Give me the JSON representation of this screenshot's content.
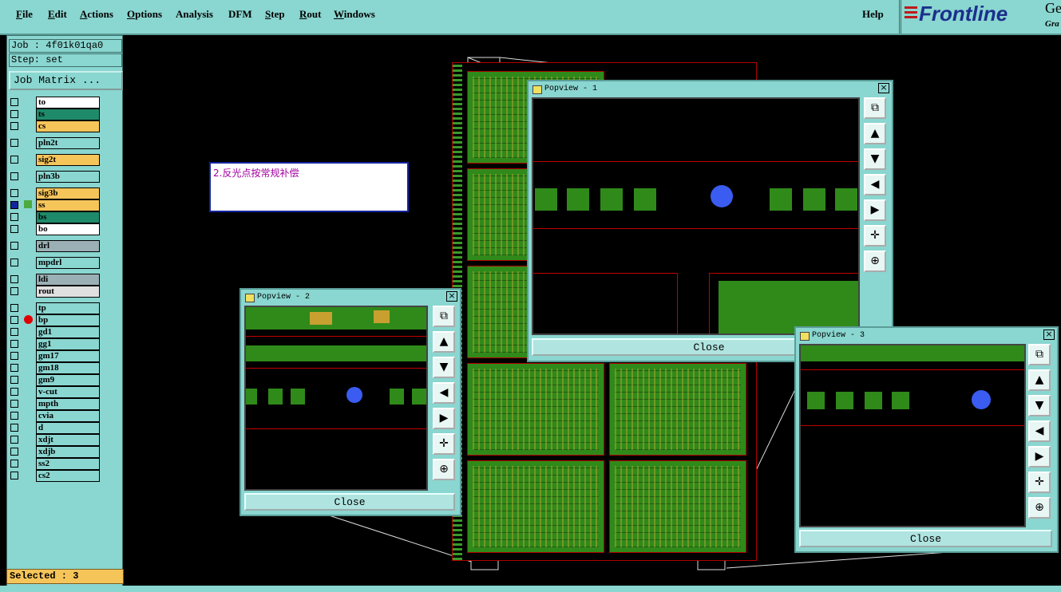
{
  "menu": {
    "items": [
      {
        "label": "File",
        "u": "F",
        "rest": "ile"
      },
      {
        "label": "Edit",
        "u": "E",
        "rest": "dit"
      },
      {
        "label": "Actions",
        "u": "A",
        "rest": "ctions"
      },
      {
        "label": "Options",
        "u": "O",
        "rest": "ptions"
      },
      {
        "label": "Analysis",
        "u": "",
        "rest": "Analysis"
      },
      {
        "label": "DFM",
        "u": "",
        "rest": "DFM"
      },
      {
        "label": "Step",
        "u": "S",
        "rest": "tep"
      },
      {
        "label": "Rout",
        "u": "R",
        "rest": "out"
      },
      {
        "label": "Windows",
        "u": "W",
        "rest": "indows"
      }
    ],
    "help": "Help"
  },
  "logo": {
    "brand": "Frontline",
    "gen": "Gen",
    "gra": "Gra"
  },
  "job": {
    "job_line": "Job : 4f01k01qa0",
    "step_line": "Step: set",
    "matrix_button": "Job Matrix ..."
  },
  "layers": [
    {
      "name": "to",
      "color": "#ffffff"
    },
    {
      "name": "ts",
      "color": "#1f8a6a"
    },
    {
      "name": "cs",
      "color": "#f6c55a"
    },
    {
      "name": "pln2t",
      "color": "#8ad6d0"
    },
    {
      "name": "sig2t",
      "color": "#f6c55a"
    },
    {
      "name": "pln3b",
      "color": "#8ad6d0"
    },
    {
      "name": "sig3b",
      "color": "#f6c55a"
    },
    {
      "name": "ss",
      "color": "#f6c55a"
    },
    {
      "name": "bs",
      "color": "#1f8a6a"
    },
    {
      "name": "bo",
      "color": "#ffffff"
    },
    {
      "name": "drl",
      "color": "#9ab0b4"
    },
    {
      "name": "mpdrl",
      "color": "#8ad6d0"
    },
    {
      "name": "ldi",
      "color": "#9ab0b4"
    },
    {
      "name": "rout",
      "color": "#e0e0e0"
    },
    {
      "name": "tp",
      "color": "#8ad6d0"
    },
    {
      "name": "bp",
      "color": "#8ad6d0"
    },
    {
      "name": "gd1",
      "color": "#8ad6d0"
    },
    {
      "name": "gg1",
      "color": "#8ad6d0"
    },
    {
      "name": "gm17",
      "color": "#8ad6d0"
    },
    {
      "name": "gm18",
      "color": "#8ad6d0"
    },
    {
      "name": "gm9",
      "color": "#8ad6d0"
    },
    {
      "name": "v-cut",
      "color": "#8ad6d0"
    },
    {
      "name": "mpth",
      "color": "#8ad6d0"
    },
    {
      "name": "cvia",
      "color": "#8ad6d0"
    },
    {
      "name": "d",
      "color": "#8ad6d0"
    },
    {
      "name": "xdjt",
      "color": "#8ad6d0"
    },
    {
      "name": "xdjb",
      "color": "#8ad6d0"
    },
    {
      "name": "ss2",
      "color": "#8ad6d0"
    },
    {
      "name": "cs2",
      "color": "#8ad6d0"
    }
  ],
  "selected": "Selected : 3",
  "note": "2.反光点按常规补偿",
  "popups": {
    "p1": {
      "title": "Popview - 1",
      "close": "Close"
    },
    "p2": {
      "title": "Popview - 2",
      "close": "Close"
    },
    "p3": {
      "title": "Popview - 3",
      "close": "Close"
    },
    "close_x": "×"
  },
  "tool_icons": [
    "fit-window-icon",
    "zoom-in-icon",
    "zoom-out-icon",
    "pan-left-icon",
    "pan-right-icon",
    "zoom-area-icon",
    "center-icon"
  ],
  "tool_glyphs": [
    "⧉",
    "▲",
    "▼",
    "◀",
    "▶",
    "✛",
    "⊕"
  ]
}
